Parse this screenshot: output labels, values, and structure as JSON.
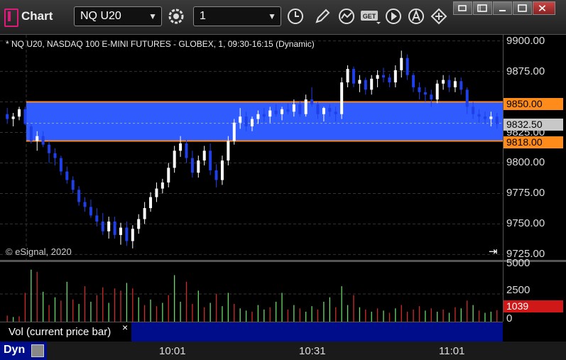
{
  "toolbar": {
    "app_title": "Chart",
    "symbol": "NQ U20",
    "interval": "1",
    "icons": [
      "settings-icon",
      "clock-icon",
      "pencil-icon",
      "studies-icon",
      "get-icon",
      "play-icon",
      "alert-icon",
      "move-icon"
    ]
  },
  "chart": {
    "header": "* NQ U20, NASDAQ 100 E-MINI FUTURES - GLOBEX, 1, 09:30-16:15 (Dynamic)",
    "copyright": "© eSignal, 2020",
    "goto_end": "⇥",
    "y_labels": [
      "9900.00",
      "9875.00",
      "9850.00",
      "9825.00",
      "9800.00",
      "9775.00",
      "9750.00",
      "9725.00"
    ],
    "price_tags": {
      "upper": "9850.00",
      "current": "9832.50",
      "lower": "9818.00"
    },
    "vol_labels": [
      "5000",
      "2500",
      "0"
    ],
    "vol_tag": "1039",
    "x_labels": [
      "10:01",
      "10:31",
      "11:01"
    ],
    "colors": {
      "up": "#ffffff",
      "down": "#1f3fe8",
      "zone": "#2f5bff",
      "zone_line": "#ff8c1a",
      "vol_up": "#6bd96b",
      "vol_down": "#d22a2a"
    }
  },
  "study": {
    "label": "Vol (current price bar)",
    "close": "×"
  },
  "bottom": {
    "dyn": "Dyn"
  },
  "chart_data": {
    "type": "candlestick",
    "y_range": [
      9720,
      9905
    ],
    "zone": [
      9818,
      9850
    ],
    "candles": [
      [
        9840,
        9845,
        9832,
        9836
      ],
      [
        9836,
        9841,
        9830,
        9838
      ],
      [
        9838,
        9846,
        9835,
        9844
      ],
      [
        9844,
        9846,
        9831,
        9832
      ],
      [
        9830,
        9832,
        9816,
        9818
      ],
      [
        9818,
        9826,
        9810,
        9822
      ],
      [
        9822,
        9826,
        9813,
        9815
      ],
      [
        9815,
        9818,
        9800,
        9808
      ],
      [
        9808,
        9812,
        9798,
        9804
      ],
      [
        9804,
        9806,
        9790,
        9793
      ],
      [
        9793,
        9797,
        9783,
        9786
      ],
      [
        9786,
        9789,
        9775,
        9778
      ],
      [
        9778,
        9781,
        9765,
        9768
      ],
      [
        9768,
        9772,
        9760,
        9764
      ],
      [
        9764,
        9770,
        9755,
        9757
      ],
      [
        9757,
        9763,
        9748,
        9752
      ],
      [
        9752,
        9759,
        9741,
        9744
      ],
      [
        9744,
        9756,
        9738,
        9752
      ],
      [
        9752,
        9756,
        9738,
        9741
      ],
      [
        9741,
        9751,
        9733,
        9747
      ],
      [
        9747,
        9752,
        9732,
        9736
      ],
      [
        9736,
        9749,
        9730,
        9746
      ],
      [
        9746,
        9758,
        9742,
        9754
      ],
      [
        9754,
        9768,
        9750,
        9763
      ],
      [
        9763,
        9776,
        9760,
        9772
      ],
      [
        9772,
        9784,
        9768,
        9779
      ],
      [
        9779,
        9787,
        9775,
        9784
      ],
      [
        9784,
        9800,
        9780,
        9796
      ],
      [
        9796,
        9814,
        9792,
        9810
      ],
      [
        9810,
        9822,
        9805,
        9816
      ],
      [
        9816,
        9819,
        9800,
        9804
      ],
      [
        9804,
        9810,
        9788,
        9792
      ],
      [
        9792,
        9806,
        9788,
        9802
      ],
      [
        9802,
        9814,
        9798,
        9810
      ],
      [
        9810,
        9816,
        9790,
        9794
      ],
      [
        9794,
        9799,
        9780,
        9786
      ],
      [
        9786,
        9806,
        9782,
        9802
      ],
      [
        9802,
        9822,
        9798,
        9818
      ],
      [
        9818,
        9836,
        9815,
        9833
      ],
      [
        9833,
        9845,
        9828,
        9838
      ],
      [
        9838,
        9842,
        9826,
        9830
      ],
      [
        9830,
        9838,
        9826,
        9836
      ],
      [
        9836,
        9843,
        9832,
        9840
      ],
      [
        9840,
        9845,
        9834,
        9838
      ],
      [
        9838,
        9846,
        9833,
        9843
      ],
      [
        9843,
        9848,
        9838,
        9840
      ],
      [
        9840,
        9846,
        9835,
        9844
      ],
      [
        9844,
        9849,
        9840,
        9842
      ],
      [
        9842,
        9852,
        9838,
        9848
      ],
      [
        9848,
        9851,
        9838,
        9840
      ],
      [
        9840,
        9856,
        9838,
        9852
      ],
      [
        9852,
        9862,
        9846,
        9848
      ],
      [
        9848,
        9850,
        9836,
        9840
      ],
      [
        9840,
        9846,
        9834,
        9845
      ],
      [
        9845,
        9848,
        9838,
        9842
      ],
      [
        9842,
        9846,
        9834,
        9840
      ],
      [
        9840,
        9870,
        9836,
        9866
      ],
      [
        9866,
        9880,
        9862,
        9877
      ],
      [
        9877,
        9879,
        9862,
        9865
      ],
      [
        9865,
        9872,
        9858,
        9868
      ],
      [
        9868,
        9870,
        9856,
        9860
      ],
      [
        9860,
        9872,
        9856,
        9869
      ],
      [
        9869,
        9876,
        9862,
        9872
      ],
      [
        9872,
        9878,
        9866,
        9870
      ],
      [
        9870,
        9873,
        9862,
        9866
      ],
      [
        9866,
        9880,
        9862,
        9876
      ],
      [
        9876,
        9892,
        9870,
        9886
      ],
      [
        9886,
        9889,
        9868,
        9872
      ],
      [
        9872,
        9874,
        9858,
        9862
      ],
      [
        9862,
        9866,
        9852,
        9858
      ],
      [
        9858,
        9862,
        9850,
        9856
      ],
      [
        9856,
        9860,
        9846,
        9852
      ],
      [
        9852,
        9868,
        9849,
        9865
      ],
      [
        9865,
        9872,
        9860,
        9868
      ],
      [
        9868,
        9872,
        9858,
        9862
      ],
      [
        9862,
        9870,
        9858,
        9867
      ],
      [
        9867,
        9870,
        9856,
        9860
      ],
      [
        9860,
        9862,
        9840,
        9846
      ],
      [
        9846,
        9850,
        9836,
        9840
      ],
      [
        9840,
        9844,
        9832,
        9838
      ],
      [
        9838,
        9842,
        9832,
        9836
      ],
      [
        9836,
        9842,
        9830,
        9838
      ],
      [
        9838,
        9841,
        9828,
        9832
      ]
    ],
    "volume": [
      [
        550,
        "down"
      ],
      [
        420,
        "up"
      ],
      [
        480,
        "down"
      ],
      [
        2600,
        "down"
      ],
      [
        4700,
        "up"
      ],
      [
        4500,
        "down"
      ],
      [
        2700,
        "up"
      ],
      [
        1500,
        "down"
      ],
      [
        2200,
        "up"
      ],
      [
        1900,
        "down"
      ],
      [
        3600,
        "up"
      ],
      [
        2000,
        "down"
      ],
      [
        1600,
        "up"
      ],
      [
        3200,
        "down"
      ],
      [
        1800,
        "up"
      ],
      [
        2400,
        "down"
      ],
      [
        3100,
        "down"
      ],
      [
        1700,
        "up"
      ],
      [
        3000,
        "down"
      ],
      [
        2800,
        "down"
      ],
      [
        3500,
        "up"
      ],
      [
        3000,
        "down"
      ],
      [
        2200,
        "up"
      ],
      [
        1500,
        "down"
      ],
      [
        2000,
        "up"
      ],
      [
        1400,
        "down"
      ],
      [
        1700,
        "up"
      ],
      [
        2400,
        "down"
      ],
      [
        4200,
        "up"
      ],
      [
        1800,
        "up"
      ],
      [
        3600,
        "down"
      ],
      [
        1600,
        "down"
      ],
      [
        2800,
        "up"
      ],
      [
        1300,
        "down"
      ],
      [
        1700,
        "up"
      ],
      [
        2500,
        "down"
      ],
      [
        1400,
        "up"
      ],
      [
        2600,
        "up"
      ],
      [
        1600,
        "down"
      ],
      [
        1200,
        "up"
      ],
      [
        1000,
        "up"
      ],
      [
        900,
        "down"
      ],
      [
        1500,
        "up"
      ],
      [
        1100,
        "up"
      ],
      [
        1300,
        "down"
      ],
      [
        1800,
        "up"
      ],
      [
        2600,
        "up"
      ],
      [
        1100,
        "down"
      ],
      [
        1500,
        "up"
      ],
      [
        1200,
        "down"
      ],
      [
        900,
        "up"
      ],
      [
        1400,
        "up"
      ],
      [
        1100,
        "down"
      ],
      [
        1800,
        "up"
      ],
      [
        2200,
        "up"
      ],
      [
        1300,
        "down"
      ],
      [
        3200,
        "up"
      ],
      [
        1500,
        "up"
      ],
      [
        2400,
        "down"
      ],
      [
        1300,
        "up"
      ],
      [
        1100,
        "down"
      ],
      [
        900,
        "up"
      ],
      [
        1200,
        "down"
      ],
      [
        1000,
        "up"
      ],
      [
        800,
        "down"
      ],
      [
        1200,
        "up"
      ],
      [
        1500,
        "down"
      ],
      [
        900,
        "down"
      ],
      [
        1100,
        "down"
      ],
      [
        1400,
        "down"
      ],
      [
        1000,
        "up"
      ],
      [
        1200,
        "down"
      ],
      [
        900,
        "up"
      ],
      [
        1100,
        "down"
      ],
      [
        800,
        "up"
      ],
      [
        1300,
        "down"
      ],
      [
        1200,
        "up"
      ],
      [
        1900,
        "down"
      ],
      [
        1500,
        "up"
      ],
      [
        1000,
        "down"
      ],
      [
        800,
        "up"
      ],
      [
        900,
        "up"
      ],
      [
        1039,
        "down"
      ]
    ]
  }
}
